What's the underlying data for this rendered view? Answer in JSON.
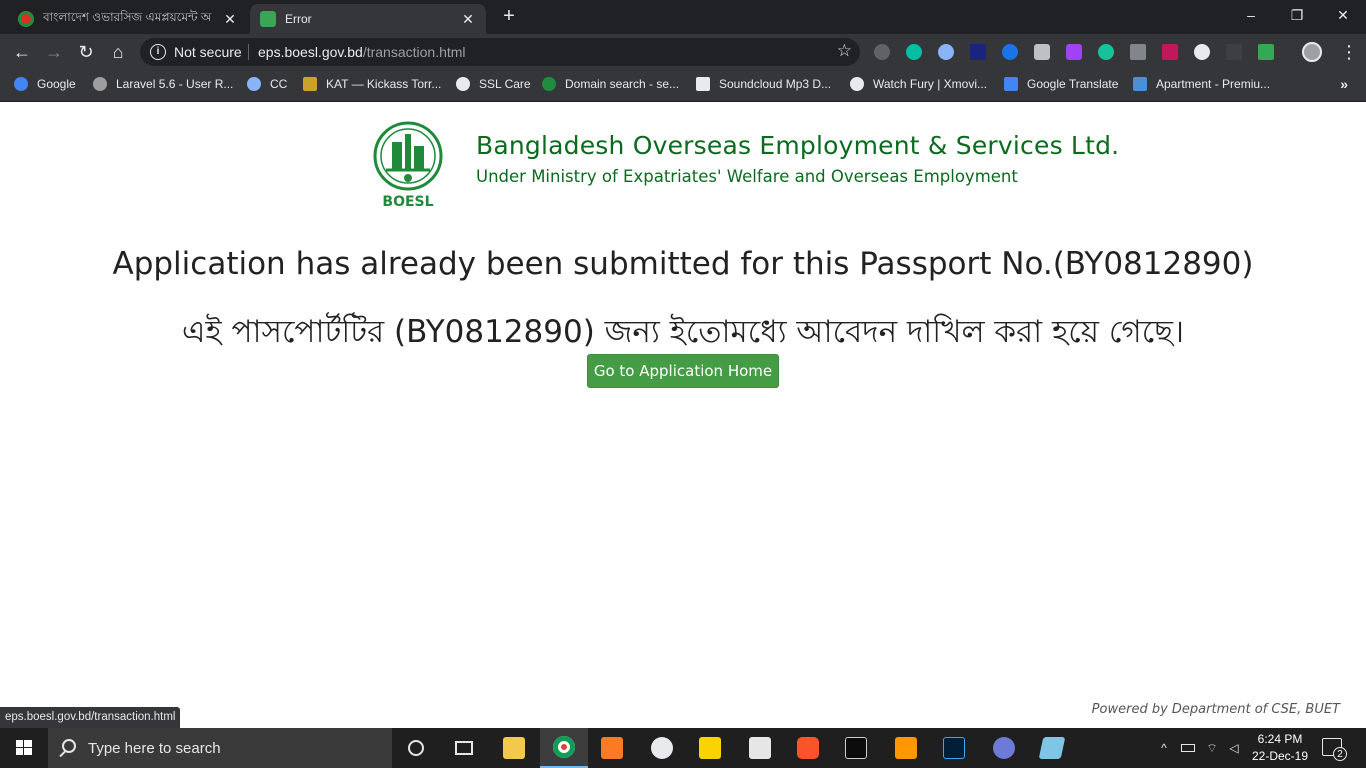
{
  "browser": {
    "tabs": [
      {
        "title": "বাংলাদেশ ওভারসিজ এমপ্লয়মেন্ট অ",
        "active": false,
        "favicon_color": "#d93025"
      },
      {
        "title": "Error",
        "active": true,
        "favicon_color": "#3aa655"
      }
    ],
    "new_tab_label": "+",
    "window_controls": {
      "minimize": "–",
      "maximize": "❐",
      "close": "✕"
    },
    "nav": {
      "back": "←",
      "forward": "→",
      "reload": "↻",
      "home": "⌂"
    },
    "omnibox": {
      "security": "Not secure",
      "host": "eps.boesl.gov.bd",
      "path": "/transaction.html"
    },
    "bookmarks": [
      {
        "label": "Google",
        "icon": "google-icon",
        "color": "#4285f4"
      },
      {
        "label": "Laravel 5.6 - User R...",
        "icon": "laravel-icon",
        "color": "#9e9e9e"
      },
      {
        "label": "CC",
        "icon": "cc-icon",
        "color": "#8ab4f8"
      },
      {
        "label": "KAT — Kickass Torr...",
        "icon": "kat-icon",
        "color": "#c9a227"
      },
      {
        "label": "SSL Care",
        "icon": "globe-icon",
        "color": "#e8eaed"
      },
      {
        "label": "Domain search - se...",
        "icon": "check-icon",
        "color": "#1e8e3e"
      },
      {
        "label": "Soundcloud Mp3 D...",
        "icon": "speaker-icon",
        "color": "#e8eaed"
      },
      {
        "label": "Watch Fury | Xmovi...",
        "icon": "globe-icon",
        "color": "#e8eaed"
      },
      {
        "label": "Google Translate",
        "icon": "translate-icon",
        "color": "#4285f4"
      },
      {
        "label": "Apartment - Premiu...",
        "icon": "house-icon",
        "color": "#4a90d9"
      }
    ],
    "bookmarks_more": "»",
    "status_url": "eps.boesl.gov.bd/transaction.html"
  },
  "page": {
    "logo_text": "BOESL",
    "org_title": "Bangladesh Overseas Employment & Services Ltd.",
    "org_subtitle": "Under Ministry of Expatriates' Welfare and Overseas Employment",
    "message_en": "Application has already been submitted for this Passport No.(BY0812890)",
    "message_bn": "এই পাসপোর্টটির (BY0812890) জন্য ইতোমধ্যে আবেদন দাখিল করা হয়ে গেছে।",
    "home_button": "Go to Application Home",
    "powered_by": "Powered by Department of CSE, BUET"
  },
  "taskbar": {
    "search_placeholder": "Type here to search",
    "time": "6:24 PM",
    "date": "22-Dec-19",
    "notification_count": "2"
  }
}
